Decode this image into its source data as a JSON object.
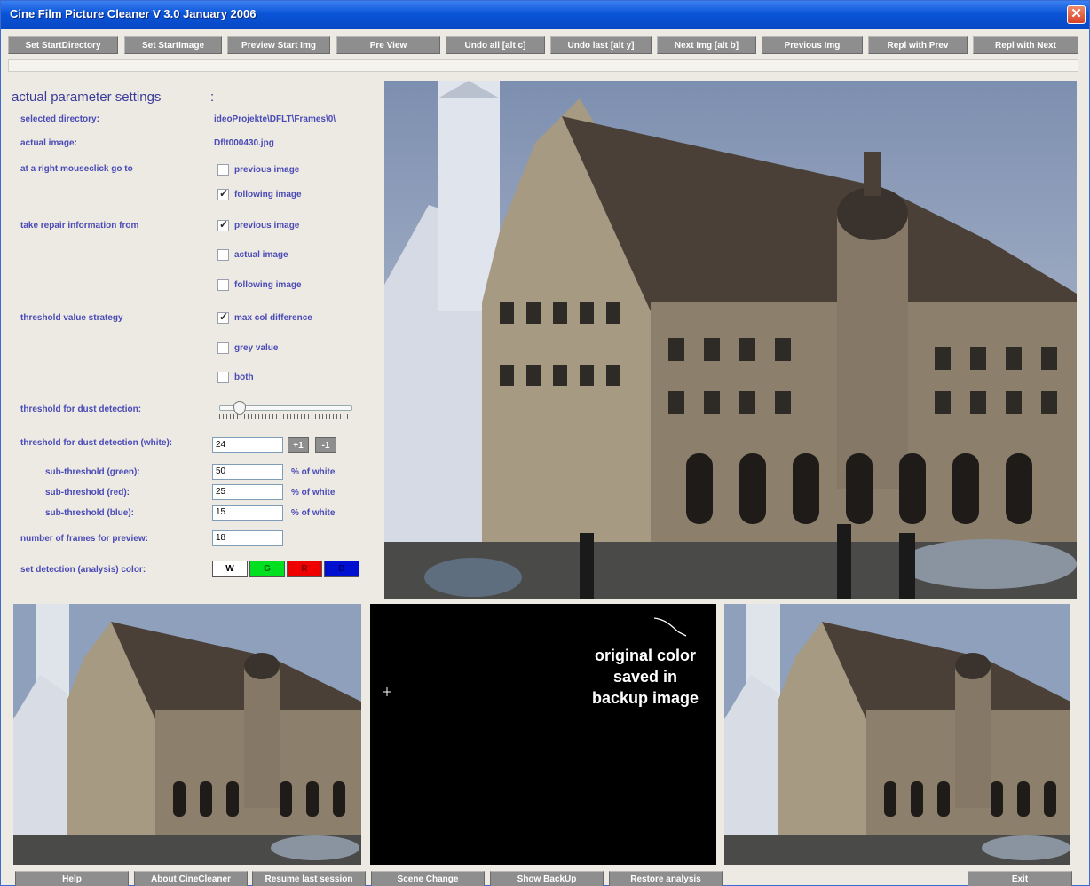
{
  "window": {
    "title": "Cine Film Picture Cleaner V 3.0 January 2006",
    "close_label": "✕"
  },
  "toolbar": [
    {
      "id": "set-start-directory",
      "label": "Set StartDirectory"
    },
    {
      "id": "set-start-image",
      "label": "Set StartImage"
    },
    {
      "id": "preview-start-img",
      "label": "Preview Start Img"
    },
    {
      "id": "pre-view",
      "label": "Pre View"
    },
    {
      "id": "undo-all",
      "label": "Undo all [alt c]"
    },
    {
      "id": "undo-last",
      "label": "Undo last [alt y]"
    },
    {
      "id": "next-img",
      "label": "Next Img [alt b]"
    },
    {
      "id": "previous-img",
      "label": "Previous Img"
    },
    {
      "id": "repl-with-prev",
      "label": "Repl with Prev"
    },
    {
      "id": "repl-with-next",
      "label": "Repl with Next"
    }
  ],
  "params": {
    "title": "actual parameter settings",
    "colon": ":",
    "selected_directory_label": "selected directory:",
    "selected_directory_value": "ideoProjekte\\DFLT\\Frames\\0\\",
    "actual_image_label": "actual image:",
    "actual_image_value": "Dflt000430.jpg",
    "right_click_label": "at a right mouseclick go to",
    "right_click_options": [
      {
        "label": "previous image",
        "checked": false
      },
      {
        "label": "following image",
        "checked": true
      }
    ],
    "repair_label": "take repair information from",
    "repair_options": [
      {
        "label": "previous image",
        "checked": true
      },
      {
        "label": "actual image",
        "checked": false
      },
      {
        "label": "following image",
        "checked": false
      }
    ],
    "threshold_strategy_label": "threshold value strategy",
    "threshold_strategy_options": [
      {
        "label": "max col difference",
        "checked": true
      },
      {
        "label": "grey value",
        "checked": false
      },
      {
        "label": "both",
        "checked": false
      }
    ],
    "dust_threshold_label": "threshold for dust detection:",
    "dust_threshold_level": 0.12,
    "dust_white_label": "threshold for dust detection (white):",
    "dust_white_value": "24",
    "plus_label": "+1",
    "minus_label": "-1",
    "sub_green_label": "sub-threshold (green):",
    "sub_green_value": "50",
    "sub_red_label": "sub-threshold (red):",
    "sub_red_value": "25",
    "sub_blue_label": "sub-threshold (blue):",
    "sub_blue_value": "15",
    "pct_white": "% of white",
    "frames_preview_label": "number of frames for preview:",
    "frames_preview_value": "18",
    "detection_color_label": "set detection (analysis) color:",
    "colors": [
      {
        "label": "W",
        "bg": "#ffffff",
        "fg": "#000000"
      },
      {
        "label": "G",
        "bg": "#00e020",
        "fg": "#006000"
      },
      {
        "label": "R",
        "bg": "#ee0000",
        "fg": "#880000"
      },
      {
        "label": "B",
        "bg": "#0010d0",
        "fg": "#000070"
      }
    ]
  },
  "center_panel": {
    "line1": "original color",
    "line2": "saved in",
    "line3": "backup image"
  },
  "bottom_buttons": [
    {
      "id": "help",
      "label": "Help"
    },
    {
      "id": "about",
      "label": "About CineCleaner"
    },
    {
      "id": "resume",
      "label": "Resume last session"
    },
    {
      "id": "scene-change",
      "label": "Scene Change"
    },
    {
      "id": "show-backup",
      "label": "Show BackUp"
    },
    {
      "id": "restore-analysis",
      "label": "Restore analysis"
    },
    {
      "id": "exit",
      "label": "Exit"
    }
  ],
  "colors": {
    "title_bar": "#0a54d8",
    "label_text": "#4a4ab8",
    "button_gray": "#8e8e8e"
  }
}
